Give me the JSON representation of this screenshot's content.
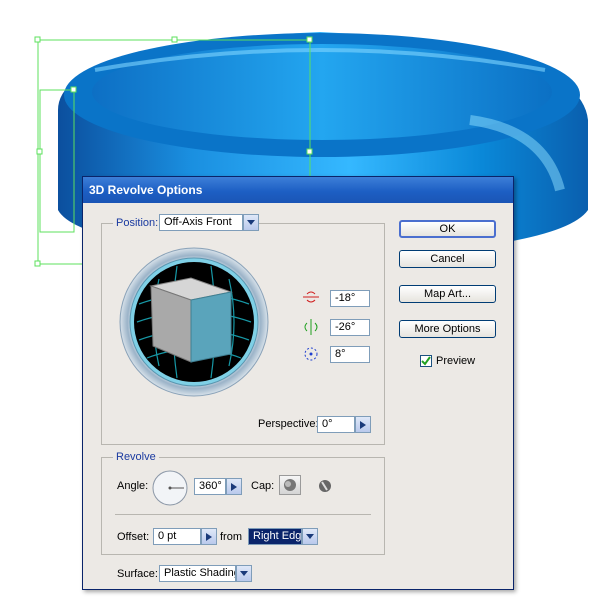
{
  "dialog": {
    "title": "3D Revolve Options",
    "position": {
      "label": "Position:",
      "value": "Off-Axis Front",
      "rotate_x": "-18°",
      "rotate_y": "-26°",
      "rotate_z": "8°",
      "perspective_label": "Perspective:",
      "perspective_value": "0°"
    },
    "revolve": {
      "label": "Revolve",
      "angle_label": "Angle:",
      "angle_value": "360°",
      "cap_label": "Cap:",
      "offset_label": "Offset:",
      "offset_value": "0 pt",
      "from_label": "from",
      "from_value": "Right Edge"
    },
    "surface": {
      "label": "Surface:",
      "value": "Plastic Shading"
    },
    "buttons": {
      "ok": "OK",
      "cancel": "Cancel",
      "map_art": "Map Art...",
      "more_options": "More Options"
    },
    "preview": {
      "label": "Preview",
      "checked": true
    }
  },
  "colors": {
    "accent": "#0a246a",
    "titlebar": "#1d5fc4",
    "ring_shape": "#0a8fd8",
    "selection_handles": "#5ce05c",
    "cube_front": "#5aa4bb",
    "cube_side": "#bdbdbd"
  }
}
